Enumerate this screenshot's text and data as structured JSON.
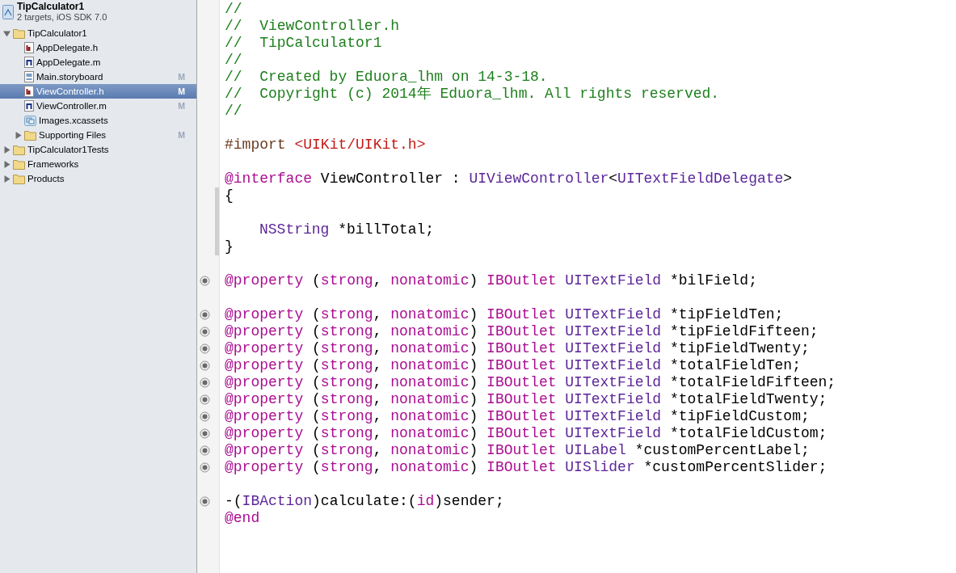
{
  "project": {
    "name": "TipCalculator1",
    "subtitle": "2 targets, iOS SDK 7.0"
  },
  "tree": [
    {
      "label": "TipCalculator1",
      "kind": "folder",
      "expanded": true,
      "selected": false,
      "children": [
        {
          "label": "AppDelegate.h",
          "kind": "header",
          "selected": false
        },
        {
          "label": "AppDelegate.m",
          "kind": "source",
          "selected": false
        },
        {
          "label": "Main.storyboard",
          "kind": "storyboard",
          "selected": false,
          "status": "M"
        },
        {
          "label": "ViewController.h",
          "kind": "header",
          "selected": true,
          "status": "M"
        },
        {
          "label": "ViewController.m",
          "kind": "source",
          "selected": false,
          "status": "M"
        },
        {
          "label": "Images.xcassets",
          "kind": "assets",
          "selected": false
        },
        {
          "label": "Supporting Files",
          "kind": "folder",
          "expanded": false,
          "selected": false,
          "status": "M"
        }
      ]
    },
    {
      "label": "TipCalculator1Tests",
      "kind": "folder",
      "expanded": false,
      "selected": false
    },
    {
      "label": "Frameworks",
      "kind": "folder",
      "expanded": false,
      "selected": false
    },
    {
      "label": "Products",
      "kind": "folder",
      "expanded": false,
      "selected": false
    }
  ],
  "code_lines": [
    {
      "kind": "code",
      "tokens": [
        {
          "kind": "comment",
          "text": "//"
        }
      ]
    },
    {
      "kind": "code",
      "tokens": [
        {
          "kind": "comment",
          "text": "//  ViewController.h"
        }
      ]
    },
    {
      "kind": "code",
      "tokens": [
        {
          "kind": "comment",
          "text": "//  TipCalculator1"
        }
      ]
    },
    {
      "kind": "code",
      "tokens": [
        {
          "kind": "comment",
          "text": "//"
        }
      ]
    },
    {
      "kind": "code",
      "tokens": [
        {
          "kind": "comment",
          "text": "//  Created by Eduora_lhm on 14-3-18."
        }
      ]
    },
    {
      "kind": "code",
      "tokens": [
        {
          "kind": "comment",
          "text": "//  Copyright (c) 2014年 Eduora_lhm. All rights reserved."
        }
      ]
    },
    {
      "kind": "code",
      "tokens": [
        {
          "kind": "comment",
          "text": "//"
        }
      ]
    },
    {
      "kind": "blank"
    },
    {
      "kind": "code",
      "tokens": [
        {
          "kind": "preproc",
          "text": "#import "
        },
        {
          "kind": "string",
          "text": "<UIKit/UIKit.h>"
        }
      ]
    },
    {
      "kind": "blank"
    },
    {
      "kind": "code",
      "tokens": [
        {
          "kind": "keyword",
          "text": "@interface"
        },
        {
          "kind": "plain",
          "text": " ViewController : "
        },
        {
          "kind": "type",
          "text": "UIViewController"
        },
        {
          "kind": "plain",
          "text": "<"
        },
        {
          "kind": "type",
          "text": "UITextFieldDelegate"
        },
        {
          "kind": "plain",
          "text": ">"
        }
      ]
    },
    {
      "kind": "code",
      "changed": true,
      "tokens": [
        {
          "kind": "plain",
          "text": "{"
        }
      ]
    },
    {
      "kind": "blank",
      "changed": true
    },
    {
      "kind": "code",
      "changed": true,
      "indent": true,
      "tokens": [
        {
          "kind": "type",
          "text": "NSString"
        },
        {
          "kind": "plain",
          "text": " *billTotal;"
        }
      ]
    },
    {
      "kind": "code",
      "changed": true,
      "tokens": [
        {
          "kind": "plain",
          "text": "}"
        }
      ]
    },
    {
      "kind": "blank"
    },
    {
      "kind": "code",
      "connected": true,
      "tokens": [
        {
          "kind": "keyword",
          "text": "@property"
        },
        {
          "kind": "plain",
          "text": " ("
        },
        {
          "kind": "keyword",
          "text": "strong"
        },
        {
          "kind": "plain",
          "text": ", "
        },
        {
          "kind": "keyword",
          "text": "nonatomic"
        },
        {
          "kind": "plain",
          "text": ") "
        },
        {
          "kind": "keyword",
          "text": "IBOutlet "
        },
        {
          "kind": "type",
          "text": "UITextField"
        },
        {
          "kind": "plain",
          "text": " *bilField;"
        }
      ]
    },
    {
      "kind": "blank"
    },
    {
      "kind": "code",
      "connected": true,
      "tokens": [
        {
          "kind": "keyword",
          "text": "@property"
        },
        {
          "kind": "plain",
          "text": " ("
        },
        {
          "kind": "keyword",
          "text": "strong"
        },
        {
          "kind": "plain",
          "text": ", "
        },
        {
          "kind": "keyword",
          "text": "nonatomic"
        },
        {
          "kind": "plain",
          "text": ") "
        },
        {
          "kind": "keyword",
          "text": "IBOutlet "
        },
        {
          "kind": "type",
          "text": "UITextField"
        },
        {
          "kind": "plain",
          "text": " *tipFieldTen;"
        }
      ]
    },
    {
      "kind": "code",
      "connected": true,
      "tokens": [
        {
          "kind": "keyword",
          "text": "@property"
        },
        {
          "kind": "plain",
          "text": " ("
        },
        {
          "kind": "keyword",
          "text": "strong"
        },
        {
          "kind": "plain",
          "text": ", "
        },
        {
          "kind": "keyword",
          "text": "nonatomic"
        },
        {
          "kind": "plain",
          "text": ") "
        },
        {
          "kind": "keyword",
          "text": "IBOutlet "
        },
        {
          "kind": "type",
          "text": "UITextField"
        },
        {
          "kind": "plain",
          "text": " *tipFieldFifteen;"
        }
      ]
    },
    {
      "kind": "code",
      "connected": true,
      "tokens": [
        {
          "kind": "keyword",
          "text": "@property"
        },
        {
          "kind": "plain",
          "text": " ("
        },
        {
          "kind": "keyword",
          "text": "strong"
        },
        {
          "kind": "plain",
          "text": ", "
        },
        {
          "kind": "keyword",
          "text": "nonatomic"
        },
        {
          "kind": "plain",
          "text": ") "
        },
        {
          "kind": "keyword",
          "text": "IBOutlet "
        },
        {
          "kind": "type",
          "text": "UITextField"
        },
        {
          "kind": "plain",
          "text": " *tipFieldTwenty;"
        }
      ]
    },
    {
      "kind": "code",
      "connected": true,
      "tokens": [
        {
          "kind": "keyword",
          "text": "@property"
        },
        {
          "kind": "plain",
          "text": " ("
        },
        {
          "kind": "keyword",
          "text": "strong"
        },
        {
          "kind": "plain",
          "text": ", "
        },
        {
          "kind": "keyword",
          "text": "nonatomic"
        },
        {
          "kind": "plain",
          "text": ") "
        },
        {
          "kind": "keyword",
          "text": "IBOutlet "
        },
        {
          "kind": "type",
          "text": "UITextField"
        },
        {
          "kind": "plain",
          "text": " *totalFieldTen;"
        }
      ]
    },
    {
      "kind": "code",
      "connected": true,
      "tokens": [
        {
          "kind": "keyword",
          "text": "@property"
        },
        {
          "kind": "plain",
          "text": " ("
        },
        {
          "kind": "keyword",
          "text": "strong"
        },
        {
          "kind": "plain",
          "text": ", "
        },
        {
          "kind": "keyword",
          "text": "nonatomic"
        },
        {
          "kind": "plain",
          "text": ") "
        },
        {
          "kind": "keyword",
          "text": "IBOutlet "
        },
        {
          "kind": "type",
          "text": "UITextField"
        },
        {
          "kind": "plain",
          "text": " *totalFieldFifteen;"
        }
      ]
    },
    {
      "kind": "code",
      "connected": true,
      "tokens": [
        {
          "kind": "keyword",
          "text": "@property"
        },
        {
          "kind": "plain",
          "text": " ("
        },
        {
          "kind": "keyword",
          "text": "strong"
        },
        {
          "kind": "plain",
          "text": ", "
        },
        {
          "kind": "keyword",
          "text": "nonatomic"
        },
        {
          "kind": "plain",
          "text": ") "
        },
        {
          "kind": "keyword",
          "text": "IBOutlet "
        },
        {
          "kind": "type",
          "text": "UITextField"
        },
        {
          "kind": "plain",
          "text": " *totalFieldTwenty;"
        }
      ]
    },
    {
      "kind": "code",
      "connected": true,
      "tokens": [
        {
          "kind": "keyword",
          "text": "@property"
        },
        {
          "kind": "plain",
          "text": " ("
        },
        {
          "kind": "keyword",
          "text": "strong"
        },
        {
          "kind": "plain",
          "text": ", "
        },
        {
          "kind": "keyword",
          "text": "nonatomic"
        },
        {
          "kind": "plain",
          "text": ") "
        },
        {
          "kind": "keyword",
          "text": "IBOutlet "
        },
        {
          "kind": "type",
          "text": "UITextField"
        },
        {
          "kind": "plain",
          "text": " *tipFieldCustom;"
        }
      ]
    },
    {
      "kind": "code",
      "connected": true,
      "tokens": [
        {
          "kind": "keyword",
          "text": "@property"
        },
        {
          "kind": "plain",
          "text": " ("
        },
        {
          "kind": "keyword",
          "text": "strong"
        },
        {
          "kind": "plain",
          "text": ", "
        },
        {
          "kind": "keyword",
          "text": "nonatomic"
        },
        {
          "kind": "plain",
          "text": ") "
        },
        {
          "kind": "keyword",
          "text": "IBOutlet "
        },
        {
          "kind": "type",
          "text": "UITextField"
        },
        {
          "kind": "plain",
          "text": " *totalFieldCustom;"
        }
      ]
    },
    {
      "kind": "code",
      "connected": true,
      "tokens": [
        {
          "kind": "keyword",
          "text": "@property"
        },
        {
          "kind": "plain",
          "text": " ("
        },
        {
          "kind": "keyword",
          "text": "strong"
        },
        {
          "kind": "plain",
          "text": ", "
        },
        {
          "kind": "keyword",
          "text": "nonatomic"
        },
        {
          "kind": "plain",
          "text": ") "
        },
        {
          "kind": "keyword",
          "text": "IBOutlet "
        },
        {
          "kind": "type",
          "text": "UILabel"
        },
        {
          "kind": "plain",
          "text": " *customPercentLabel;"
        }
      ]
    },
    {
      "kind": "code",
      "connected": true,
      "tokens": [
        {
          "kind": "keyword",
          "text": "@property"
        },
        {
          "kind": "plain",
          "text": " ("
        },
        {
          "kind": "keyword",
          "text": "strong"
        },
        {
          "kind": "plain",
          "text": ", "
        },
        {
          "kind": "keyword",
          "text": "nonatomic"
        },
        {
          "kind": "plain",
          "text": ") "
        },
        {
          "kind": "keyword",
          "text": "IBOutlet "
        },
        {
          "kind": "type",
          "text": "UISlider"
        },
        {
          "kind": "plain",
          "text": " *customPercentSlider;"
        }
      ]
    },
    {
      "kind": "blank"
    },
    {
      "kind": "code",
      "connected": true,
      "tokens": [
        {
          "kind": "plain",
          "text": "-("
        },
        {
          "kind": "type",
          "text": "IBAction"
        },
        {
          "kind": "plain",
          "text": ")calculate:("
        },
        {
          "kind": "keyword",
          "text": "id"
        },
        {
          "kind": "plain",
          "text": ")sender;"
        }
      ]
    },
    {
      "kind": "code",
      "tokens": [
        {
          "kind": "keyword",
          "text": "@end"
        }
      ]
    }
  ]
}
